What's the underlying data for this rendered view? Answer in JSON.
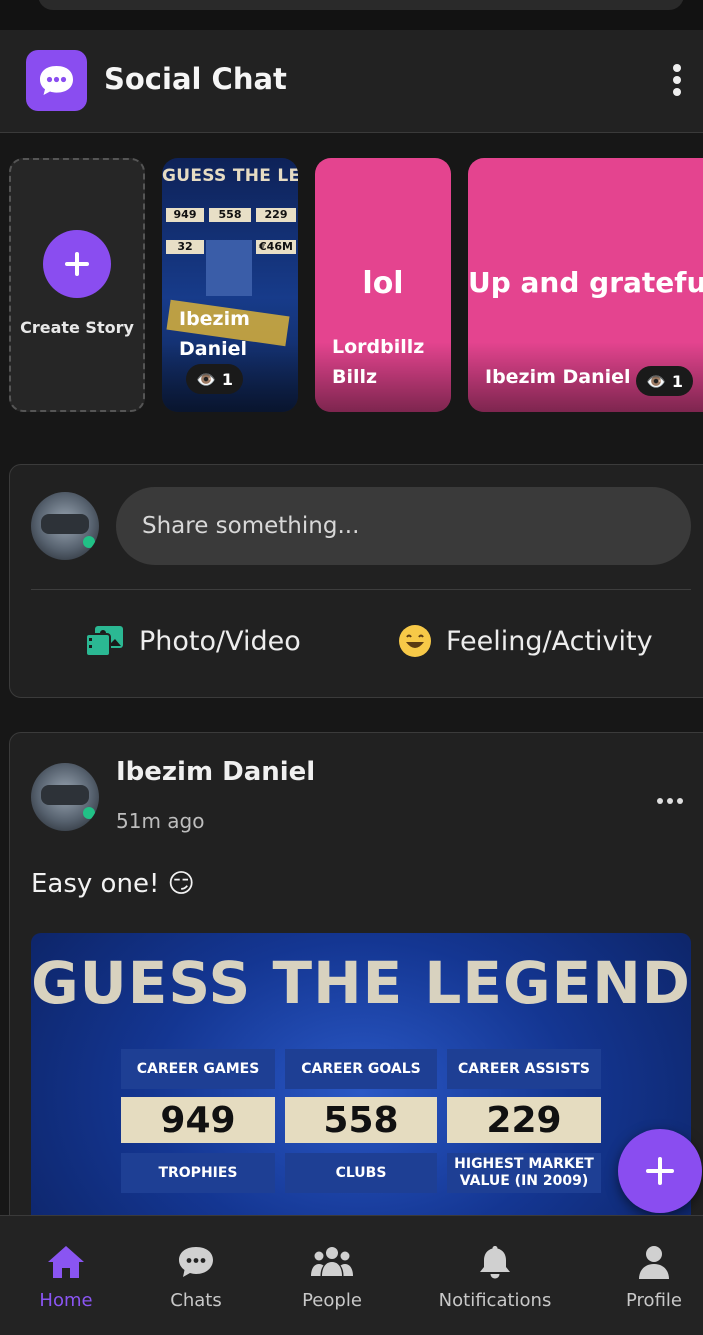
{
  "app": {
    "title": "Social Chat",
    "accent": "#8a4df0",
    "story_pink": "#e4448f",
    "online_color": "#21c186"
  },
  "stories": {
    "create_label": "Create Story",
    "items": [
      {
        "author": "Ibezim Daniel",
        "views": "1",
        "kind": "image",
        "poster_title": "GUESS THE LEGEND",
        "poster_values": [
          "949",
          "558",
          "229",
          "32",
          "€46M"
        ]
      },
      {
        "author": "Lordbillz Billz",
        "kind": "text",
        "text": "lol"
      },
      {
        "author": "Ibezim Daniel",
        "views": "1",
        "kind": "text",
        "text": "Up and grateful"
      }
    ]
  },
  "composer": {
    "placeholder": "Share something...",
    "photo_label": "Photo/Video",
    "feeling_label": "Feeling/Activity",
    "photo_icon": "photo-video-icon",
    "feeling_icon": "smiley-icon"
  },
  "post": {
    "author": "Ibezim Daniel",
    "time": "51m ago",
    "text": "Easy one! 😏",
    "image": {
      "title": "GUESS THE LEGEND",
      "headers": [
        "CAREER GAMES",
        "CAREER GOALS",
        "CAREER ASSISTS",
        "TROPHIES",
        "CLUBS",
        "HIGHEST MARKET VALUE (IN 2009)"
      ],
      "values": [
        "949",
        "558",
        "229"
      ]
    }
  },
  "nav": {
    "items": [
      {
        "label": "Home",
        "icon": "home-icon",
        "active": true
      },
      {
        "label": "Chats",
        "icon": "chat-bubble-icon",
        "active": false
      },
      {
        "label": "People",
        "icon": "people-icon",
        "active": false
      },
      {
        "label": "Notifications",
        "icon": "bell-icon",
        "active": false
      },
      {
        "label": "Profile",
        "icon": "user-icon",
        "active": false
      }
    ]
  }
}
